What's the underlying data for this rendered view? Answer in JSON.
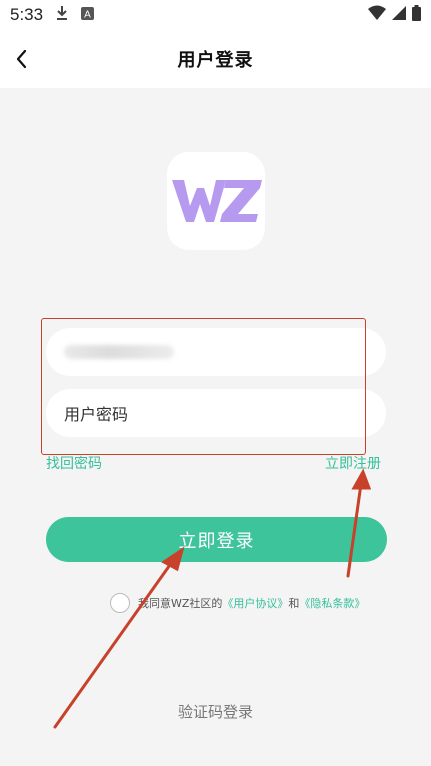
{
  "status_bar": {
    "time": "5:33",
    "icons": [
      "download-icon",
      "a-badge-icon",
      "wifi-icon",
      "signal-icon",
      "battery-icon"
    ]
  },
  "nav": {
    "title": "用户登录",
    "back_icon": "chevron-left-icon"
  },
  "logo": {
    "text": "WZ",
    "color": "#b69af0"
  },
  "form": {
    "account_value_obscured": true,
    "password_placeholder": "用户密码",
    "forgot_link": "找回密码",
    "register_link": "立即注册",
    "login_button": "立即登录"
  },
  "agreement": {
    "prefix": "我同意WZ社区的",
    "user_agreement": "《用户协议》",
    "and": "和",
    "privacy_policy": "《隐私条款》"
  },
  "alt_login": "验证码登录",
  "colors": {
    "accent_green": "#3dc49a",
    "link_green": "#34c09a",
    "annotation_red": "#c8412a",
    "logo_purple": "#b69af0"
  }
}
